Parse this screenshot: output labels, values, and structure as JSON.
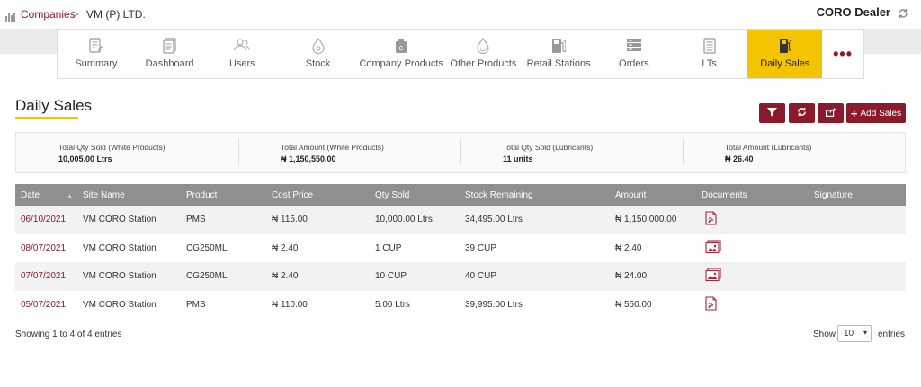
{
  "breadcrumb": {
    "link": "Companies",
    "separator": ">",
    "current": "VM (P) LTD."
  },
  "header": {
    "user_role": "CORO Dealer"
  },
  "nav": {
    "items": [
      {
        "label": "Summary",
        "icon": "summary-icon"
      },
      {
        "label": "Dashboard",
        "icon": "dashboard-icon"
      },
      {
        "label": "Users",
        "icon": "users-icon"
      },
      {
        "label": "Stock",
        "icon": "stock-icon"
      },
      {
        "label": "Company Products",
        "icon": "company-products-icon"
      },
      {
        "label": "Other Products",
        "icon": "other-products-icon"
      },
      {
        "label": "Retail Stations",
        "icon": "fuel-station-icon"
      },
      {
        "label": "Orders",
        "icon": "orders-icon"
      },
      {
        "label": "LTs",
        "icon": "lts-icon"
      },
      {
        "label": "Daily Sales",
        "icon": "fuel-pump-icon",
        "active": true
      }
    ],
    "more": "•••"
  },
  "page": {
    "title": "Daily Sales"
  },
  "toolbar": {
    "add_label": "Add Sales"
  },
  "summary": [
    {
      "label": "Total Qty Sold (White Products)",
      "value": "10,005.00 Ltrs"
    },
    {
      "label": "Total Amount (White Products)",
      "value": "₦ 1,150,550.00"
    },
    {
      "label": "Total Qty Sold (Lubricants)",
      "value": "11 units"
    },
    {
      "label": "Total Amount (Lubricants)",
      "value": "₦ 26.40"
    }
  ],
  "table": {
    "headers": [
      "Date",
      "Site Name",
      "Product",
      "Cost Price",
      "Qty Sold",
      "Stock Remaining",
      "Amount",
      "Documents",
      "Signature"
    ],
    "rows": [
      {
        "date": "06/10/2021",
        "site": "VM CORO Station",
        "product": "PMS",
        "cost": "₦ 115.00",
        "qty": "10,000.00 Ltrs",
        "stock": "34,495.00 Ltrs",
        "amount": "₦ 1,150,000.00",
        "doc": "pdf-icon"
      },
      {
        "date": "08/07/2021",
        "site": "VM CORO Station",
        "product": "CG250ML",
        "cost": "₦ 2.40",
        "qty": "1 CUP",
        "stock": "39 CUP",
        "amount": "₦ 2.40",
        "doc": "image-icon"
      },
      {
        "date": "07/07/2021",
        "site": "VM CORO Station",
        "product": "CG250ML",
        "cost": "₦ 2.40",
        "qty": "10 CUP",
        "stock": "40 CUP",
        "amount": "₦ 24.00",
        "doc": "image-icon"
      },
      {
        "date": "05/07/2021",
        "site": "VM CORO Station",
        "product": "PMS",
        "cost": "₦ 110.00",
        "qty": "5.00 Ltrs",
        "stock": "39,995.00 Ltrs",
        "amount": "₦ 550.00",
        "doc": "pdf-icon"
      }
    ]
  },
  "footer": {
    "info": "Showing 1 to 4 of 4 entries",
    "show_label": "Show",
    "page_size": "10",
    "entries_label": "entries"
  },
  "colors": {
    "accent": "#8b1a2b",
    "active_tab": "#f5c400",
    "table_header": "#8f8f8f"
  }
}
